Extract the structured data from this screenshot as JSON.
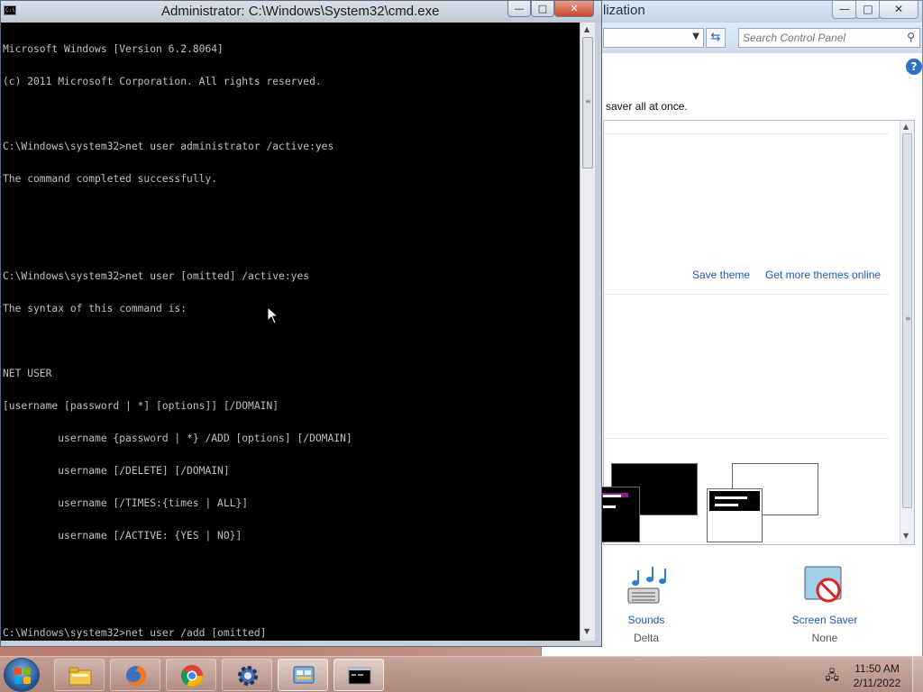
{
  "control_panel": {
    "title": "lization",
    "controls": {
      "minimize": "—",
      "maximize": "□",
      "close": "✕"
    },
    "search": {
      "placeholder": "Search Control Panel"
    },
    "description": "saver all at once.",
    "links": {
      "save_theme": "Save theme",
      "get_more_themes": "Get more themes online"
    },
    "bottom_items": [
      {
        "label": "Sounds",
        "value": "Delta",
        "icon": "music-notes-icon"
      },
      {
        "label": "Screen Saver",
        "value": "None",
        "icon": "screen-saver-icon"
      }
    ],
    "help_icon": "?"
  },
  "cmd": {
    "title": "Administrator: C:\\Windows\\System32\\cmd.exe",
    "icon_text": "C:\\",
    "controls": {
      "minimize": "—",
      "maximize": "□",
      "close": "✕"
    },
    "lines": [
      "Microsoft Windows [Version 6.2.8064]",
      "(c) 2011 Microsoft Corporation. All rights reserved.",
      "",
      "C:\\Windows\\system32>net user administrator /active:yes",
      "The command completed successfully.",
      "",
      "",
      "C:\\Windows\\system32>net user [omitted] /active:yes",
      "The syntax of this command is:",
      "",
      "NET USER",
      "[username [password | *] [options]] [/DOMAIN]",
      "         username {password | *} /ADD [options] [/DOMAIN]",
      "         username [/DELETE] [/DOMAIN]",
      "         username [/TIMES:{times | ALL}]",
      "         username [/ACTIVE: {YES | NO}]",
      "",
      "",
      "C:\\Windows\\system32>net user /add [omitted]"
    ]
  },
  "taskbar": {
    "items": [
      {
        "name": "explorer",
        "icon": "folder-icon",
        "active": false
      },
      {
        "name": "firefox",
        "icon": "firefox-icon",
        "active": false
      },
      {
        "name": "chrome",
        "icon": "chrome-icon",
        "active": false
      },
      {
        "name": "settings",
        "icon": "gear-icon",
        "active": false
      },
      {
        "name": "control-panel",
        "icon": "control-panel-icon",
        "active": true
      },
      {
        "name": "cmd",
        "icon": "cmd-icon",
        "active": true
      }
    ],
    "clock": {
      "time": "11:50 AM",
      "date": "2/11/2022"
    },
    "tray_icon": "network-icon"
  },
  "colors": {
    "console_bg": "#000000",
    "console_fg": "#c0c0c0",
    "link": "#1e5aa8",
    "close_button": "#c8452c"
  }
}
